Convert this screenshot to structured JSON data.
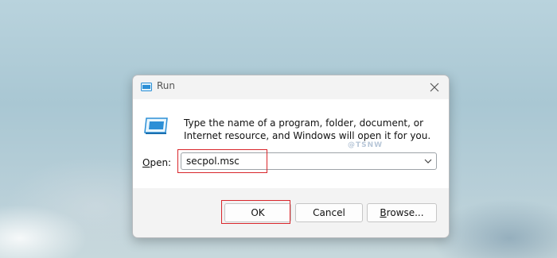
{
  "window": {
    "title": "Run",
    "close_icon": "close-icon"
  },
  "dialog": {
    "description": "Type the name of a program, folder, document, or Internet resource, and Windows will open it for you.",
    "watermark": "@TSNW",
    "open_label_prefix": "O",
    "open_label_rest": "pen:",
    "open_value": "secpol.msc"
  },
  "buttons": {
    "ok_label": "OK",
    "cancel_label": "Cancel",
    "browse_label_prefix": "B",
    "browse_label_rest": "rowse..."
  },
  "colors": {
    "highlight": "#d9262b",
    "dialog_bg": "#f3f3f3",
    "content_bg": "#ffffff"
  }
}
